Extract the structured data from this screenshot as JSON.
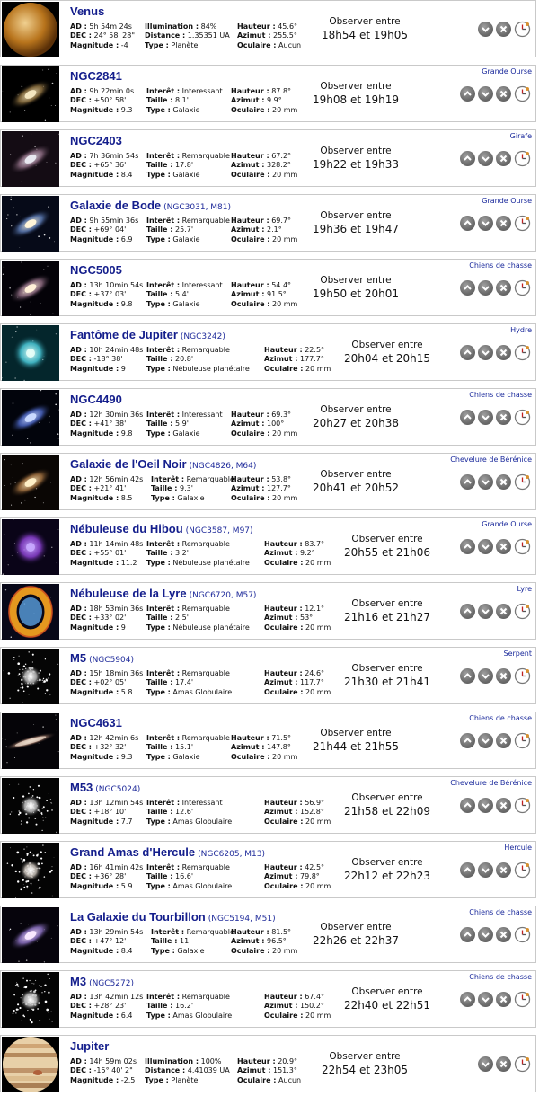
{
  "labels": {
    "ad": "AD :",
    "dec": "DEC :",
    "mag": "Magnitude :",
    "illum": "Illumination :",
    "dist": "Distance :",
    "type": "Type :",
    "interet": "Interêt :",
    "taille": "Taille :",
    "hauteur": "Hauteur :",
    "azimut": "Azimut :",
    "oculaire": "Oculaire :",
    "observe": "Observer entre"
  },
  "objects": [
    {
      "name": "Venus",
      "catalog": "",
      "constellation": "",
      "kind": "planet",
      "ad": "5h 54m 24s",
      "dec": "24° 58' 28\"",
      "mag": "-4",
      "illum": "84%",
      "dist": "1.35351 UA",
      "type": "Planète",
      "hauteur": "45.6°",
      "azimut": "255.5°",
      "oculaire": "Aucun",
      "obs_time": "18h54 et 19h05",
      "up": false,
      "colors": [
        "#f0d090",
        "#b8741c",
        "#5a3008"
      ]
    },
    {
      "name": "NGC2841",
      "catalog": "",
      "constellation": "Grande Ourse",
      "kind": "galaxy",
      "ad": "9h 22min 0s",
      "dec": "+50° 58'",
      "mag": "9.3",
      "interet": "Interessant",
      "taille": "8.1'",
      "type": "Galaxie",
      "hauteur": "87.8°",
      "azimut": "9.9°",
      "oculaire": "20 mm",
      "obs_time": "19h08 et 19h19",
      "up": true,
      "colors": [
        "#f4e6c0",
        "#8c7040",
        "#000000"
      ]
    },
    {
      "name": "NGC2403",
      "catalog": "",
      "constellation": "Girafe",
      "kind": "galaxy",
      "ad": "7h 36min 54s",
      "dec": "+65° 36'",
      "mag": "8.4",
      "interet": "Remarquable",
      "taille": "17.8'",
      "type": "Galaxie",
      "hauteur": "67.2°",
      "azimut": "328.2°",
      "oculaire": "20 mm",
      "obs_time": "19h22 et 19h33",
      "up": true,
      "colors": [
        "#e8e8f0",
        "#8a6a80",
        "#140c14"
      ]
    },
    {
      "name": "Galaxie de Bode",
      "catalog": "(NGC3031, M81)",
      "constellation": "Grande Ourse",
      "kind": "galaxy",
      "ad": "9h 55min 36s",
      "dec": "+69° 04'",
      "mag": "6.9",
      "interet": "Remarquable",
      "taille": "25.7'",
      "type": "Galaxie",
      "hauteur": "69.7°",
      "azimut": "2.1°",
      "oculaire": "20 mm",
      "obs_time": "19h36 et 19h47",
      "up": true,
      "colors": [
        "#fff4d8",
        "#5a78b0",
        "#060a18"
      ]
    },
    {
      "name": "NGC5005",
      "catalog": "",
      "constellation": "Chiens de chasse",
      "kind": "galaxy",
      "ad": "13h 10min 54s",
      "dec": "+37° 03'",
      "mag": "9.8",
      "interet": "Interessant",
      "taille": "5.4'",
      "type": "Galaxie",
      "hauteur": "54.4°",
      "azimut": "91.5°",
      "oculaire": "20 mm",
      "obs_time": "19h50 et 20h01",
      "up": true,
      "colors": [
        "#fff0d8",
        "#8c6a80",
        "#040208"
      ]
    },
    {
      "name": "Fantôme de Jupiter",
      "catalog": "(NGC3242)",
      "constellation": "Hydre",
      "kind": "nebula",
      "ad": "10h 24min 48s",
      "dec": "-18° 38'",
      "mag": "9",
      "interet": "Remarquable",
      "taille": "20.8'",
      "type": "Nébuleuse planétaire",
      "hauteur": "22.5°",
      "azimut": "177.7°",
      "oculaire": "20 mm",
      "obs_time": "20h04 et 20h15",
      "up": true,
      "colors": [
        "#e8fff8",
        "#48c8d8",
        "#04262c"
      ]
    },
    {
      "name": "NGC4490",
      "catalog": "",
      "constellation": "Chiens de chasse",
      "kind": "galaxy",
      "ad": "12h 30min 36s",
      "dec": "+41° 38'",
      "mag": "9.8",
      "interet": "Interessant",
      "taille": "5.9'",
      "type": "Galaxie",
      "hauteur": "69.3°",
      "azimut": "100°",
      "oculaire": "20 mm",
      "obs_time": "20h27 et 20h38",
      "up": true,
      "colors": [
        "#c8d8ff",
        "#4a64c0",
        "#02040c"
      ]
    },
    {
      "name": "Galaxie de l'Oeil Noir",
      "catalog": "(NGC4826, M64)",
      "constellation": "Chevelure de Bérénice",
      "kind": "galaxy",
      "ad": "12h 56min 42s",
      "dec": "+21° 41'",
      "mag": "8.5",
      "interet": "Remarquable",
      "taille": "9.3'",
      "type": "Galaxie",
      "hauteur": "53.8°",
      "azimut": "127.7°",
      "oculaire": "20 mm",
      "obs_time": "20h41 et 20h52",
      "up": true,
      "colors": [
        "#fff0c8",
        "#a07040",
        "#0a0604"
      ]
    },
    {
      "name": "Nébuleuse du Hibou",
      "catalog": "(NGC3587, M97)",
      "constellation": "Grande Ourse",
      "kind": "nebula",
      "ad": "11h 14min 48s",
      "dec": "+55° 01'",
      "mag": "11.2",
      "interet": "Remarquable",
      "taille": "3.2'",
      "type": "Nébuleuse planétaire",
      "hauteur": "83.7°",
      "azimut": "9.2°",
      "oculaire": "20 mm",
      "obs_time": "20h55 et 21h06",
      "up": true,
      "colors": [
        "#c8a8ff",
        "#8a40d0",
        "#0a0418"
      ]
    },
    {
      "name": "Nébuleuse de la Lyre",
      "catalog": "(NGC6720, M57)",
      "constellation": "Lyre",
      "kind": "ring",
      "ad": "18h 53min 36s",
      "dec": "+33° 02'",
      "mag": "9",
      "interet": "Remarquable",
      "taille": "2.5'",
      "type": "Nébuleuse planétaire",
      "hauteur": "12.1°",
      "azimut": "53°",
      "oculaire": "20 mm",
      "obs_time": "21h16 et 21h27",
      "up": true,
      "colors": [
        "#5aa0e0",
        "#f0a020",
        "#080818"
      ]
    },
    {
      "name": "M5",
      "catalog": "(NGC5904)",
      "constellation": "Serpent",
      "kind": "cluster",
      "ad": "15h 18min 36s",
      "dec": "+02° 05'",
      "mag": "5.8",
      "interet": "Remarquable",
      "taille": "17.4'",
      "type": "Amas Globulaire",
      "hauteur": "24.6°",
      "azimut": "117.7°",
      "oculaire": "20 mm",
      "obs_time": "21h30 et 21h41",
      "up": true,
      "colors": [
        "#ffffff",
        "#b8b8b8",
        "#050505"
      ]
    },
    {
      "name": "NGC4631",
      "catalog": "",
      "constellation": "Chiens de chasse",
      "kind": "edgeon",
      "ad": "12h 42min 6s",
      "dec": "+32° 32'",
      "mag": "9.3",
      "interet": "Remarquable",
      "taille": "15.1'",
      "type": "Galaxie",
      "hauteur": "71.5°",
      "azimut": "147.8°",
      "oculaire": "20 mm",
      "obs_time": "21h44 et 21h55",
      "up": true,
      "colors": [
        "#f0e0d0",
        "#a07a6a",
        "#050408"
      ]
    },
    {
      "name": "M53",
      "catalog": "(NGC5024)",
      "constellation": "Chevelure de Bérénice",
      "kind": "cluster",
      "ad": "13h 12min 54s",
      "dec": "+18° 10'",
      "mag": "7.7",
      "interet": "Interessant",
      "taille": "12.6'",
      "type": "Amas Globulaire",
      "hauteur": "56.9°",
      "azimut": "152.8°",
      "oculaire": "20 mm",
      "obs_time": "21h58 et 22h09",
      "up": true,
      "colors": [
        "#ffffff",
        "#c0c0c0",
        "#040404"
      ]
    },
    {
      "name": "Grand Amas d'Hercule",
      "catalog": "(NGC6205, M13)",
      "constellation": "Hercule",
      "kind": "cluster",
      "ad": "16h 41min 42s",
      "dec": "+36° 28'",
      "mag": "5.9",
      "interet": "Remarquable",
      "taille": "16.6'",
      "type": "Amas Globulaire",
      "hauteur": "42.5°",
      "azimut": "79.8°",
      "oculaire": "20 mm",
      "obs_time": "22h12 et 22h23",
      "up": true,
      "colors": [
        "#ffffff",
        "#c8c0b8",
        "#040404"
      ]
    },
    {
      "name": "La Galaxie du Tourbillon",
      "catalog": "(NGC5194, M51)",
      "constellation": "Chiens de chasse",
      "kind": "galaxy",
      "ad": "13h 29min 54s",
      "dec": "+47° 12'",
      "mag": "8.4",
      "interet": "Remarquable",
      "taille": "11'",
      "type": "Galaxie",
      "hauteur": "81.5°",
      "azimut": "96.5°",
      "oculaire": "20 mm",
      "obs_time": "22h26 et 22h37",
      "up": true,
      "colors": [
        "#f8e8ff",
        "#8a70c0",
        "#06040c"
      ]
    },
    {
      "name": "M3",
      "catalog": "(NGC5272)",
      "constellation": "Chiens de chasse",
      "kind": "cluster",
      "ad": "13h 42min 12s",
      "dec": "+28° 23'",
      "mag": "6.4",
      "interet": "Remarquable",
      "taille": "16.2'",
      "type": "Amas Globulaire",
      "hauteur": "67.4°",
      "azimut": "150.2°",
      "oculaire": "20 mm",
      "obs_time": "22h40 et 22h51",
      "up": true,
      "colors": [
        "#ffffff",
        "#c0c0c0",
        "#040404"
      ]
    },
    {
      "name": "Jupiter",
      "catalog": "",
      "constellation": "",
      "kind": "jupiter",
      "ad": "14h 59m 02s",
      "dec": "-15° 40' 2\"",
      "mag": "-2.5",
      "illum": "100%",
      "dist": "4.41039 UA",
      "type": "Planète",
      "hauteur": "20.9°",
      "azimut": "151.3°",
      "oculaire": "Aucun",
      "obs_time": "22h54 et 23h05",
      "up": false,
      "colors": [
        "#e8d0a8",
        "#b88a58",
        "#000000"
      ]
    }
  ]
}
